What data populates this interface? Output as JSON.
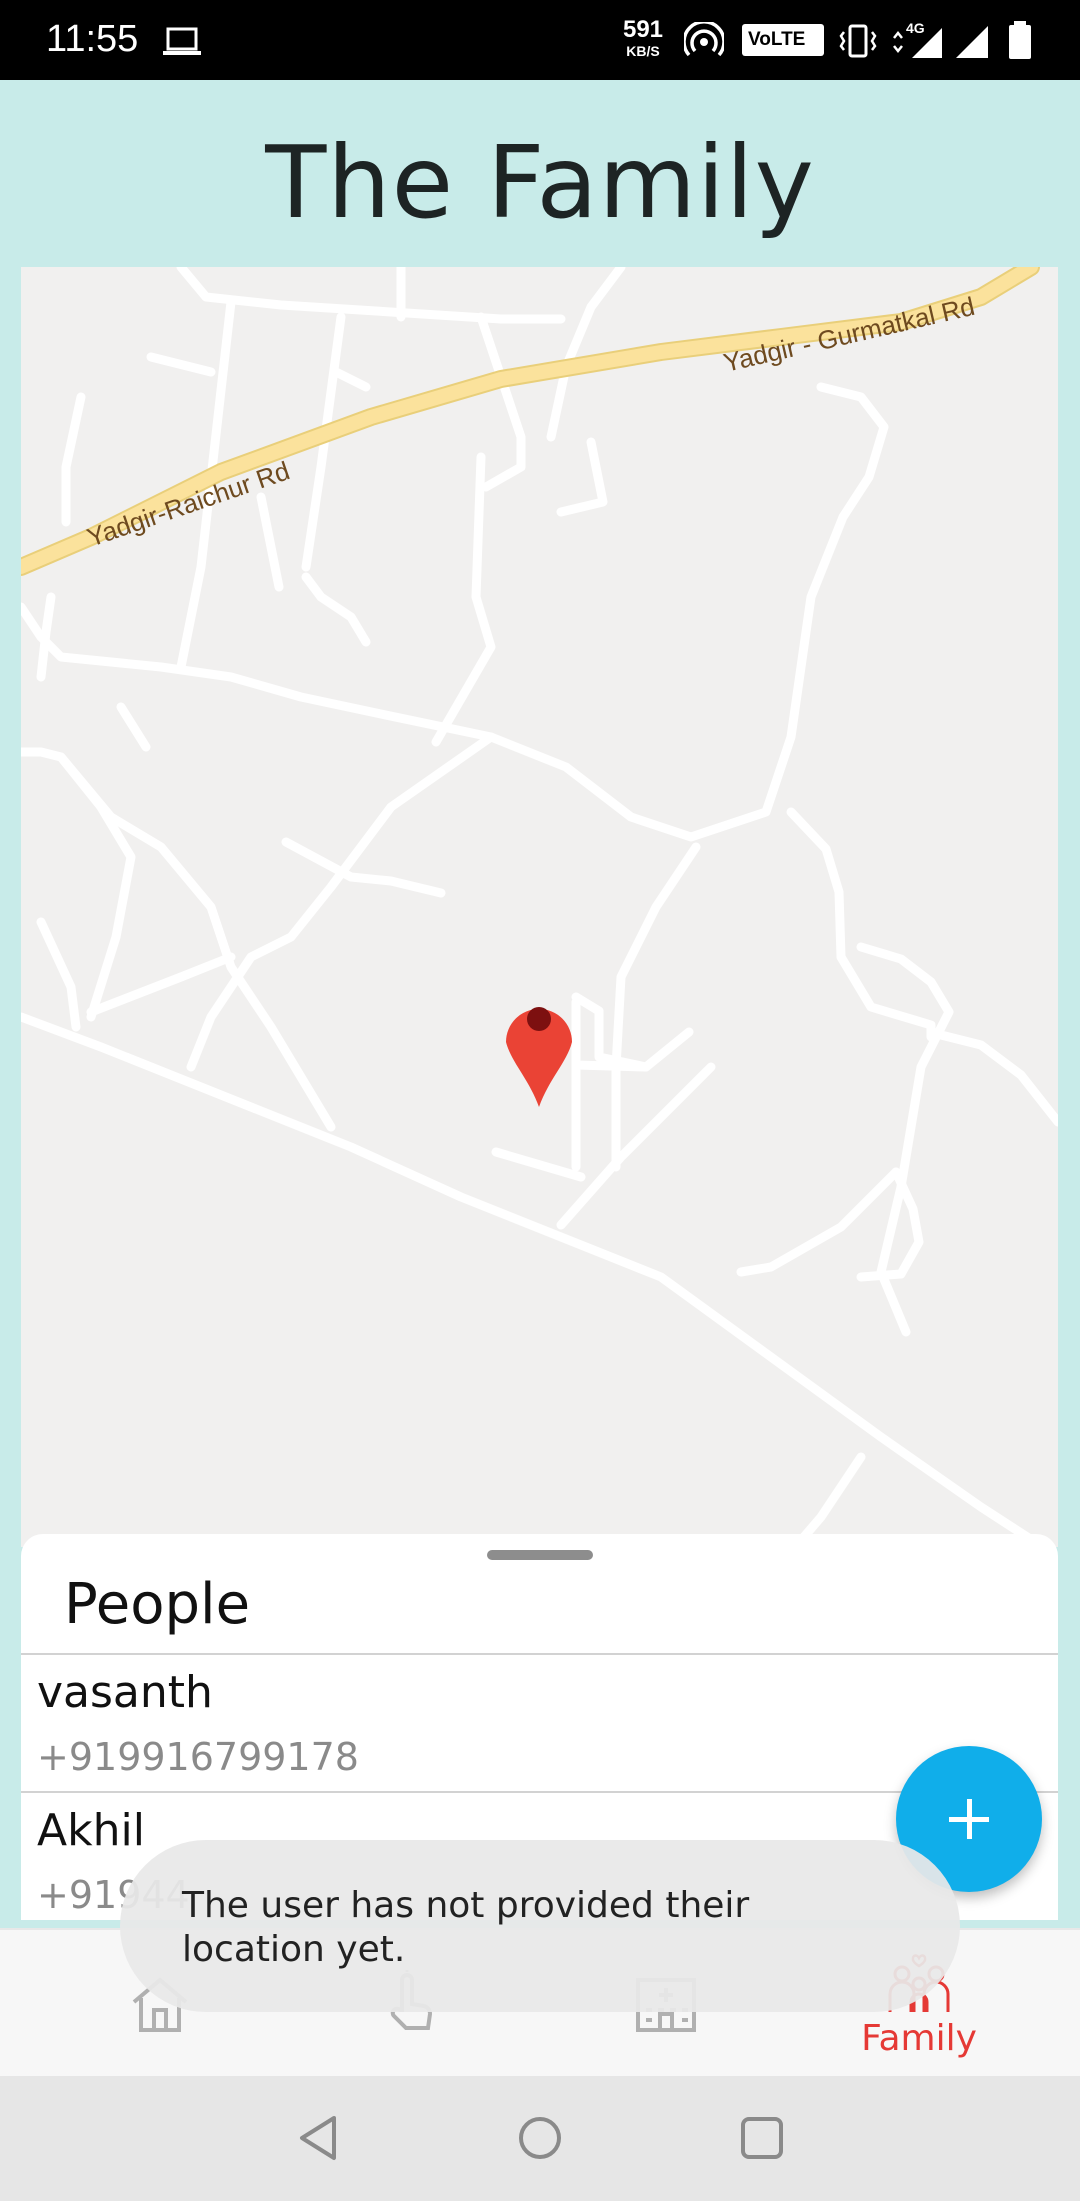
{
  "status_bar": {
    "time": "11:55",
    "net_speed_value": "591",
    "net_speed_unit": "KB/S",
    "volte_label": "VoLTE",
    "network_type": "4G",
    "icons": [
      "laptop-icon",
      "hotspot-icon",
      "vibrate-icon",
      "signal-icon",
      "battery-icon"
    ]
  },
  "header": {
    "title": "The Family"
  },
  "map": {
    "road_labels": [
      "Yadgir - Gurmatkal Rd",
      "Yadgir-Raichur Rd"
    ],
    "marker": "location-pin-icon",
    "colors": {
      "background": "#f1f0ef",
      "roads": "#ffffff",
      "highway": "#fbe29c",
      "marker": "#ea4335"
    }
  },
  "people_sheet": {
    "title": "People",
    "people": [
      {
        "name": "vasanth",
        "phone": "+919916799178"
      },
      {
        "name": "Akhil",
        "phone": "+91944"
      }
    ]
  },
  "fab": {
    "icon": "plus-icon",
    "color": "#10aeea"
  },
  "toast": {
    "message": "The user has not provided their location yet."
  },
  "bottom_nav": {
    "items": [
      {
        "icon": "home-icon",
        "label": ""
      },
      {
        "icon": "touch-icon",
        "label": ""
      },
      {
        "icon": "hospital-icon",
        "label": ""
      },
      {
        "icon": "family-icon",
        "label": "Family",
        "active": true
      }
    ],
    "active_color": "#e53935"
  },
  "system_nav": {
    "icons": [
      "back-icon",
      "home-circle-icon",
      "recents-icon"
    ]
  }
}
